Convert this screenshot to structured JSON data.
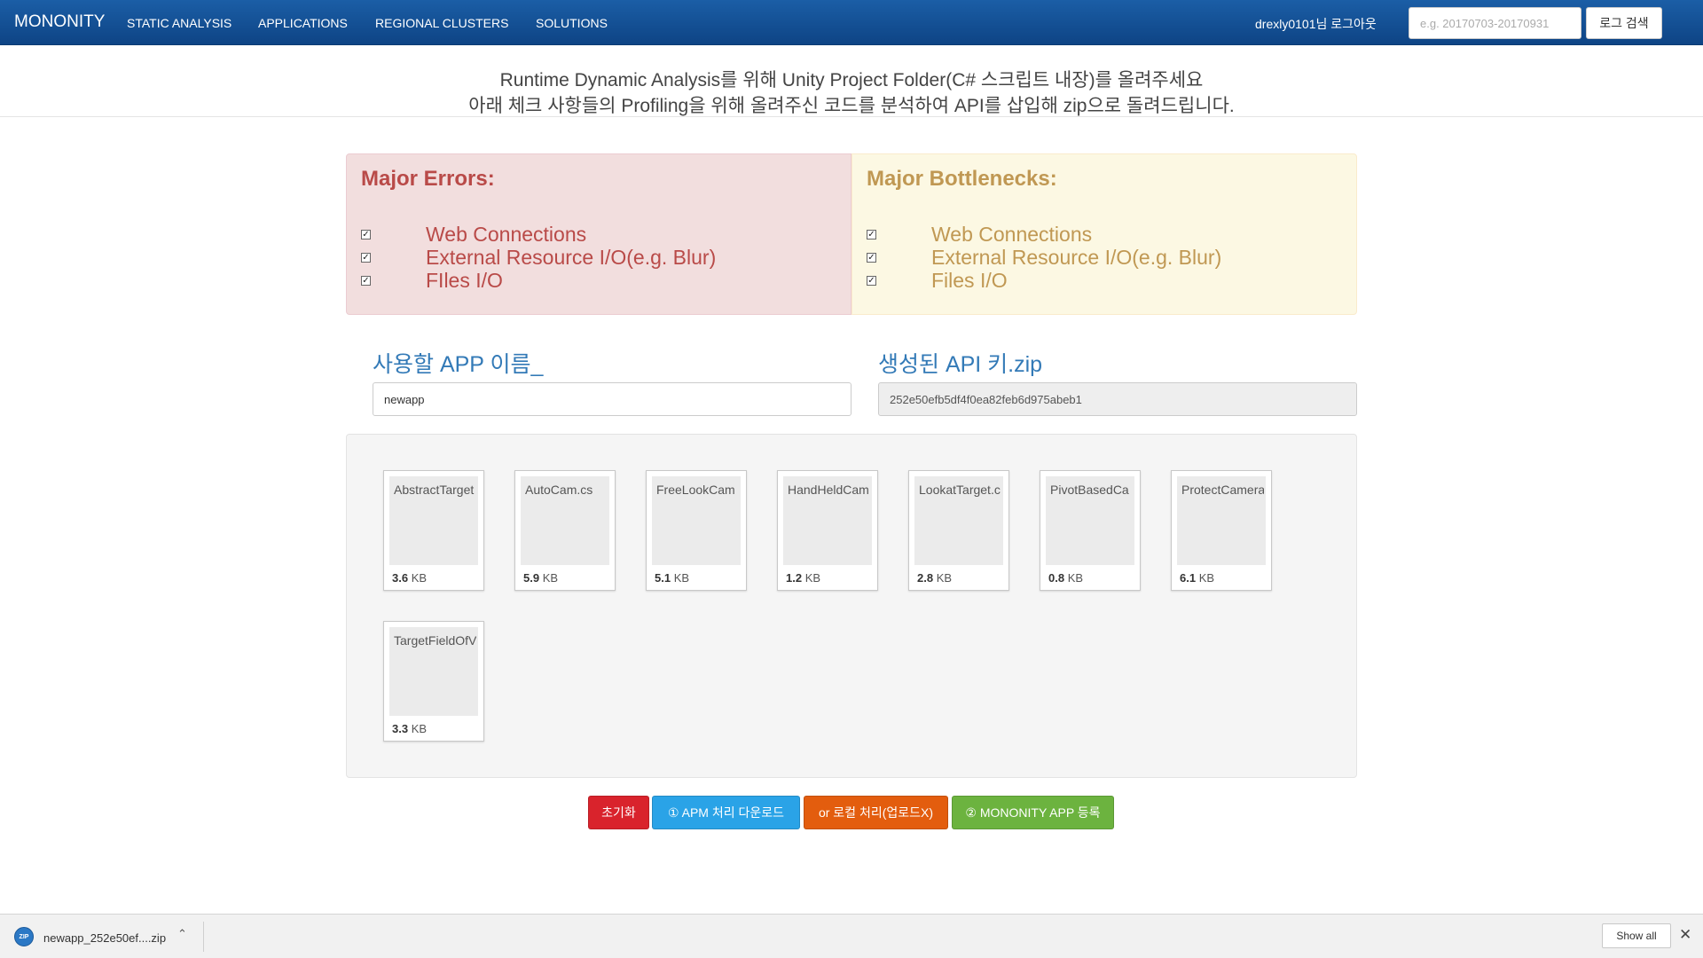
{
  "navbar": {
    "brand": "MONONITY",
    "links": [
      "STATIC ANALYSIS",
      "APPLICATIONS",
      "REGIONAL CLUSTERS",
      "SOLUTIONS"
    ],
    "user": "drexly0101님 로그아웃",
    "search_placeholder": "e.g. 20170703-20170931",
    "search_button": "로그 검색"
  },
  "header": {
    "line1": "Runtime Dynamic Analysis를 위해 Unity Project Folder(C# 스크립트 내장)를 올려주세요",
    "line2": "아래 체크 사항들의 Profiling을 위해 올려주신 코드를 분석하여 API를 삽입해 zip으로 돌려드립니다."
  },
  "errors_panel": {
    "title": "Major Errors:",
    "items": [
      "Web Connections",
      "External Resource I/O(e.g. Blur)",
      "FIles I/O"
    ],
    "color": "#b94a48"
  },
  "bottlenecks_panel": {
    "title": "Major Bottlenecks:",
    "items": [
      "Web Connections",
      "External Resource I/O(e.g. Blur)",
      "Files I/O"
    ],
    "color": "#c09853"
  },
  "form": {
    "app_name_label": "사용할 APP 이름_",
    "app_name_value": "newapp",
    "api_key_label": "생성된 API 키.zip",
    "api_key_value": "252e50efb5df4f0ea82feb6d975abeb1"
  },
  "files": [
    {
      "name": "AbstractTarget",
      "size": "3.6",
      "unit": "KB"
    },
    {
      "name": "AutoCam.cs",
      "size": "5.9",
      "unit": "KB"
    },
    {
      "name": "FreeLookCam",
      "size": "5.1",
      "unit": "KB"
    },
    {
      "name": "HandHeldCam",
      "size": "1.2",
      "unit": "KB"
    },
    {
      "name": "LookatTarget.c",
      "size": "2.8",
      "unit": "KB"
    },
    {
      "name": "PivotBasedCa",
      "size": "0.8",
      "unit": "KB"
    },
    {
      "name": "ProtectCamera",
      "size": "6.1",
      "unit": "KB"
    },
    {
      "name": "TargetFieldOfV",
      "size": "3.3",
      "unit": "KB"
    }
  ],
  "actions": {
    "reset": "초기화",
    "apm_download": "① APM 처리 다운로드",
    "local": "or 로컬 처리(업로드X)",
    "register": "② MONONITY APP 등록"
  },
  "download_shelf": {
    "file_name": "newapp_252e50ef....zip",
    "file_icon": "zip-icon",
    "show_all": "Show all"
  }
}
